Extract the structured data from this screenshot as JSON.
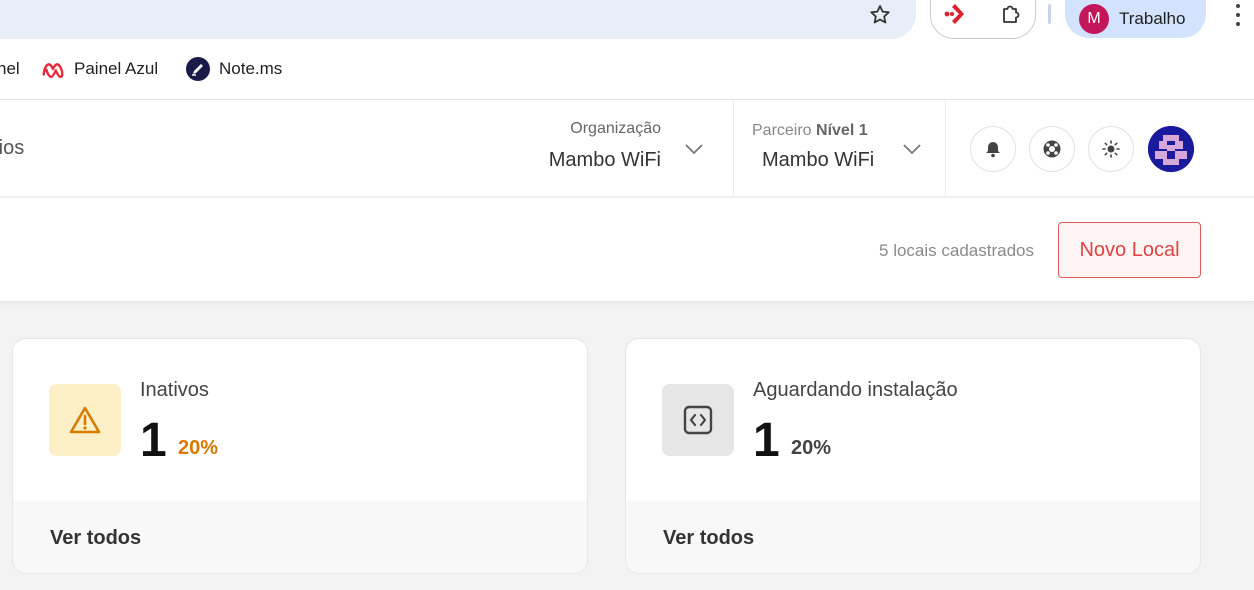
{
  "browser": {
    "profile_initial": "M",
    "profile_name": "Trabalho",
    "bookmarks": [
      {
        "label": "nel",
        "icon": "bookmark-icon"
      },
      {
        "label": "Painel Azul",
        "icon": "meta-logo-icon"
      },
      {
        "label": "Note.ms",
        "icon": "note-pen-icon"
      }
    ]
  },
  "header": {
    "title_partial": "rios",
    "organization_label": "Organização",
    "organization_value": "Mambo WiFi",
    "partner_label": "Parceiro",
    "partner_level": "Nível 1",
    "partner_value": "Mambo WiFi"
  },
  "subheader": {
    "count_text": "5 locais cadastrados",
    "new_button": "Novo Local"
  },
  "cards": [
    {
      "title": "Inativos",
      "value": "1",
      "percent": "20%",
      "link": "Ver todos",
      "icon": "warning-icon",
      "accent": "#d97a00",
      "icon_bg": "#fdf0c6"
    },
    {
      "title": "Aguardando instalação",
      "value": "1",
      "percent": "20%",
      "link": "Ver todos",
      "icon": "code-icon",
      "accent": "#444444",
      "icon_bg": "#e6e6e6"
    }
  ],
  "colors": {
    "brand_red": "#e0433f",
    "omnibox": "#e8eef7",
    "profile_chip": "#d3e3fd"
  }
}
